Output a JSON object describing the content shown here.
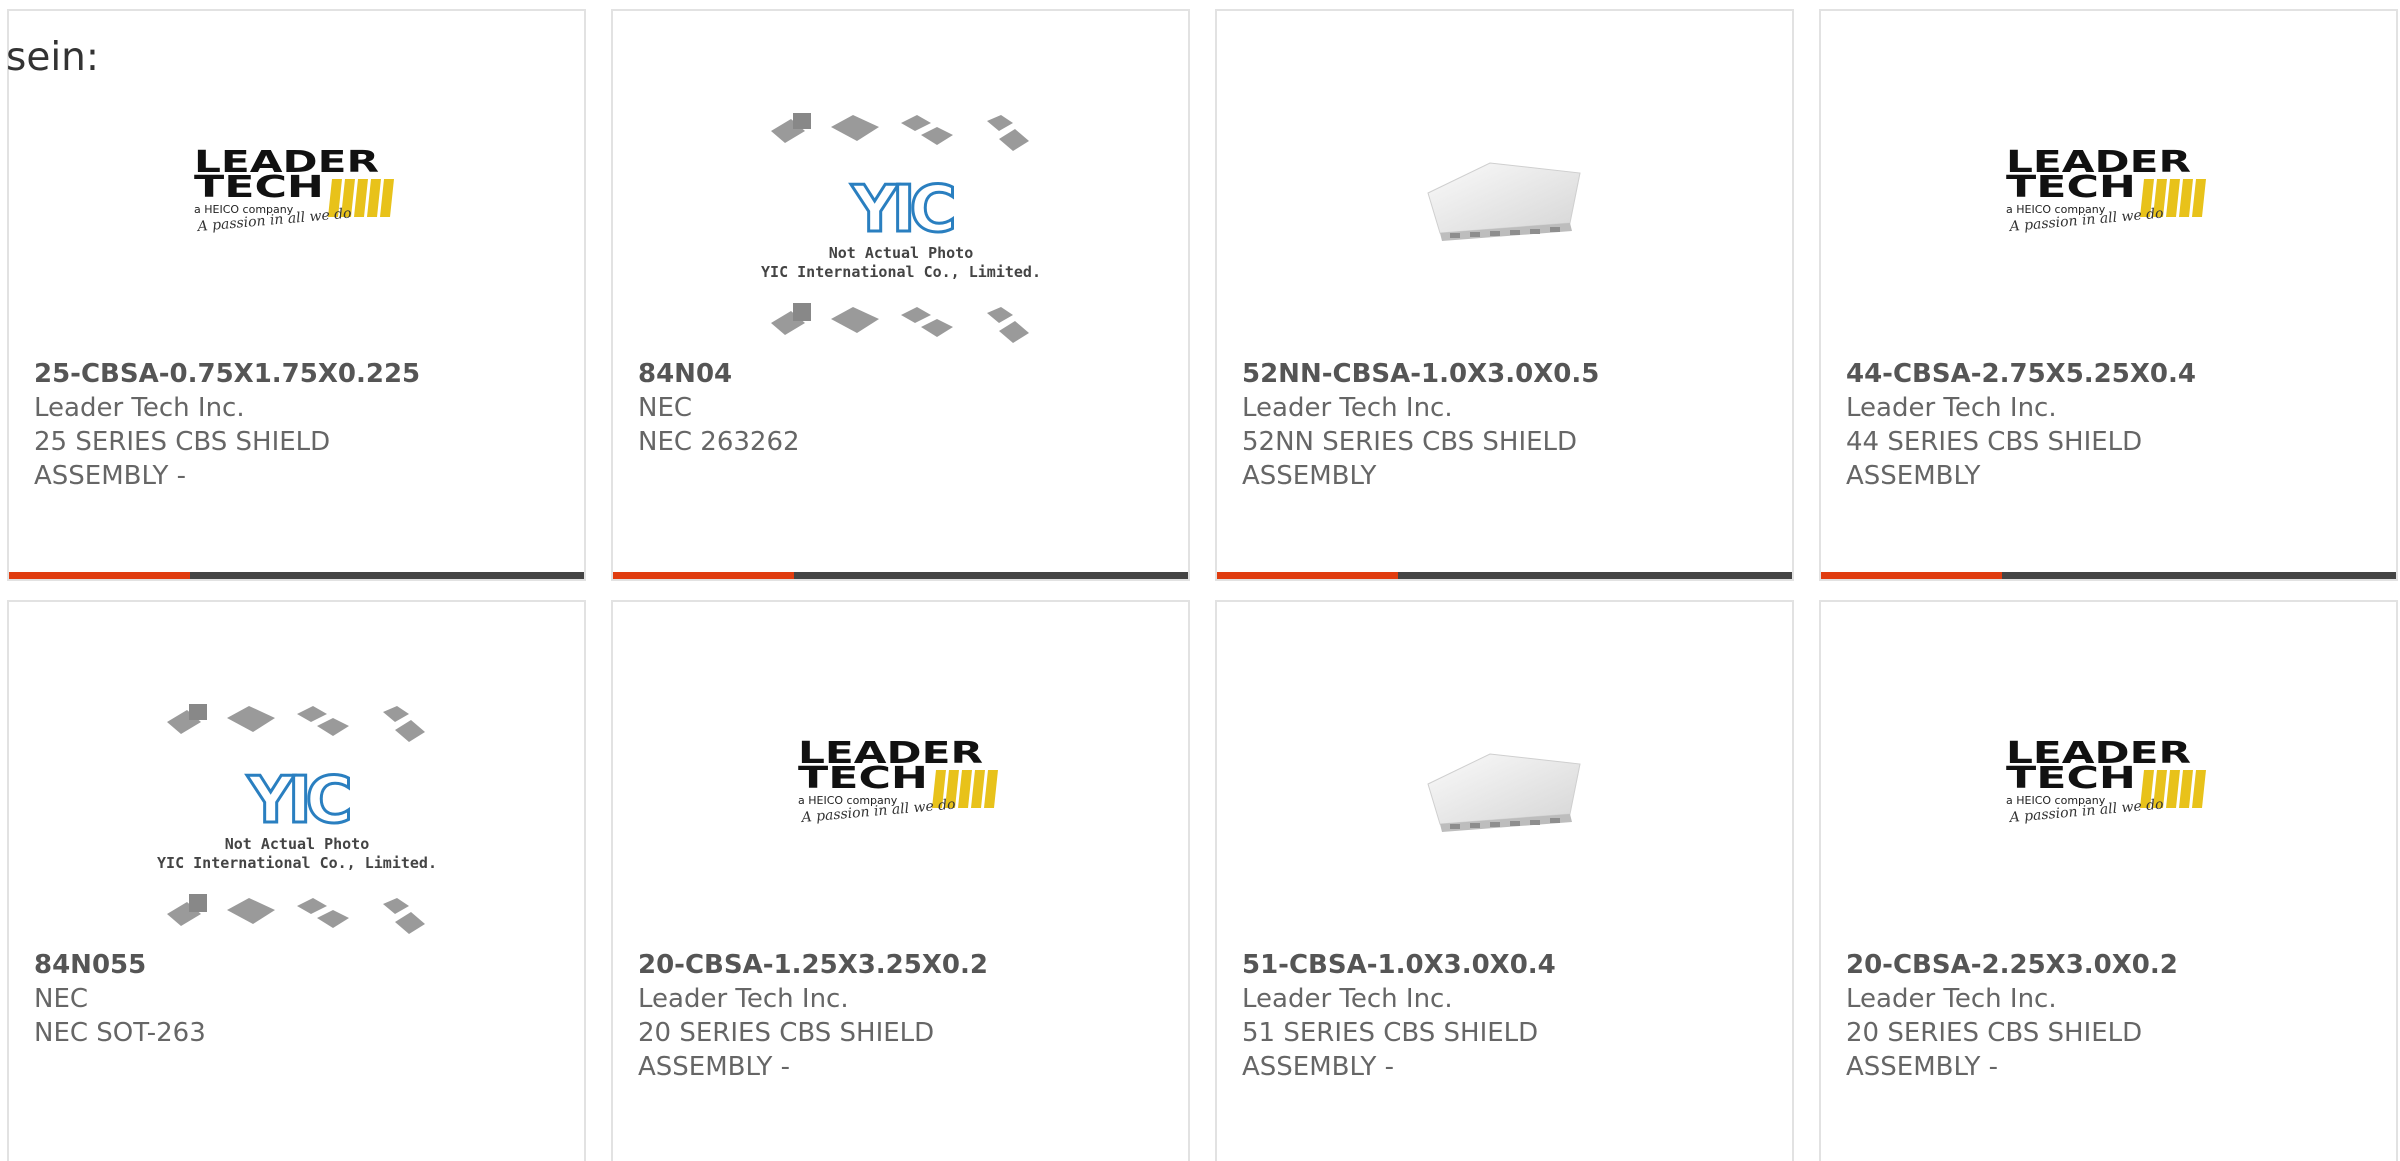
{
  "intro_text": "sein:",
  "accent_color": "#e03c0f",
  "bar_color": "#444444",
  "leader_logo": {
    "line1": "LEADER",
    "line2": "TECH",
    "tagline": "a HEICO company",
    "script": "A passion in all we do"
  },
  "yic_placeholder": {
    "mark": "YIC",
    "line1": "Not Actual Photo",
    "line2": "YIC International Co., Limited."
  },
  "products": [
    {
      "part": "25-CBSA-0.75X1.75X0.225",
      "maker": "Leader Tech Inc.",
      "desc1": "25 SERIES CBS SHIELD",
      "desc2": "ASSEMBLY -",
      "image": "leader-tech-logo"
    },
    {
      "part": "84N04",
      "maker": "NEC",
      "desc1": "NEC 263262",
      "desc2": "",
      "image": "yic-placeholder"
    },
    {
      "part": "52NN-CBSA-1.0X3.0X0.5",
      "maker": "Leader Tech Inc.",
      "desc1": "52NN SERIES CBS SHIELD",
      "desc2": "ASSEMBLY",
      "image": "shield-photo"
    },
    {
      "part": "44-CBSA-2.75X5.25X0.4",
      "maker": "Leader Tech Inc.",
      "desc1": "44 SERIES CBS SHIELD",
      "desc2": "ASSEMBLY",
      "image": "leader-tech-logo"
    },
    {
      "part": "84N055",
      "maker": "NEC",
      "desc1": "NEC SOT-263",
      "desc2": "",
      "image": "yic-placeholder"
    },
    {
      "part": "20-CBSA-1.25X3.25X0.2",
      "maker": "Leader Tech Inc.",
      "desc1": "20 SERIES CBS SHIELD",
      "desc2": "ASSEMBLY -",
      "image": "leader-tech-logo"
    },
    {
      "part": "51-CBSA-1.0X3.0X0.4",
      "maker": "Leader Tech Inc.",
      "desc1": "51 SERIES CBS SHIELD",
      "desc2": "ASSEMBLY -",
      "image": "shield-photo"
    },
    {
      "part": "20-CBSA-2.25X3.0X0.2",
      "maker": "Leader Tech Inc.",
      "desc1": "20 SERIES CBS SHIELD",
      "desc2": "ASSEMBLY -",
      "image": "leader-tech-logo"
    }
  ]
}
